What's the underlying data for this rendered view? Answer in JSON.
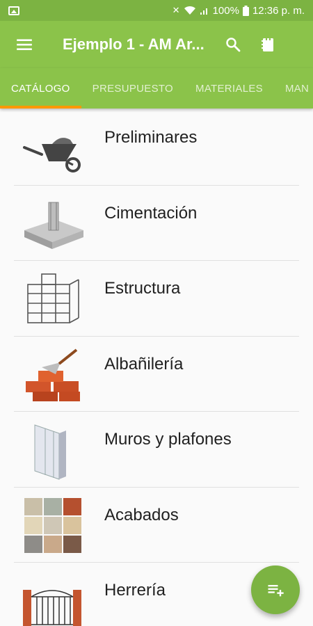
{
  "status_bar": {
    "battery": "100%",
    "time": "12:36 p. m."
  },
  "app_bar": {
    "title": "Ejemplo 1 - AM Ar..."
  },
  "tabs": [
    {
      "label": "CATÁLOGO",
      "active": true
    },
    {
      "label": "PRESUPUESTO",
      "active": false
    },
    {
      "label": "MATERIALES",
      "active": false
    },
    {
      "label": "MAN",
      "active": false
    }
  ],
  "catalog": [
    {
      "label": "Preliminares",
      "icon": "wheelbarrow-icon"
    },
    {
      "label": "Cimentación",
      "icon": "foundation-icon"
    },
    {
      "label": "Estructura",
      "icon": "structure-icon"
    },
    {
      "label": "Albañilería",
      "icon": "bricks-trowel-icon"
    },
    {
      "label": "Muros y plafones",
      "icon": "drywall-icon"
    },
    {
      "label": "Acabados",
      "icon": "finish-tiles-icon"
    },
    {
      "label": "Herrería",
      "icon": "ironwork-gate-icon"
    }
  ],
  "colors": {
    "primary": "#8bc34a",
    "primary_dark": "#7cb342",
    "tab_indicator": "#ff9800"
  }
}
